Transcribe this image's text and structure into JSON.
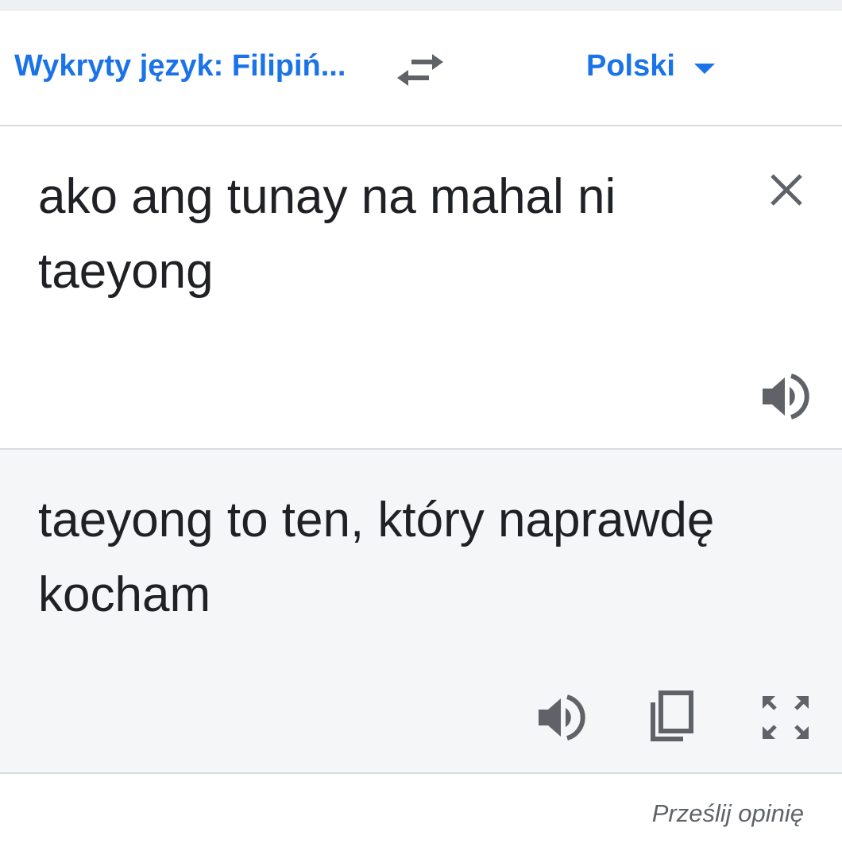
{
  "lang_bar": {
    "source_language": "Wykryty język: Filipiń...",
    "target_language": "Polski"
  },
  "source": {
    "text": "ako ang tunay na mahal ni taeyong"
  },
  "translation": {
    "text": "taeyong to ten, który naprawdę kocham"
  },
  "footer": {
    "feedback_label": "Prześlij opinię"
  },
  "icons": {
    "swap": "swap-arrows-icon",
    "dropdown": "caret-down-icon",
    "clear": "close-icon",
    "speaker": "speaker-icon",
    "copy": "copy-icon",
    "fullscreen": "fullscreen-icon"
  },
  "colors": {
    "accent": "#1a73e8",
    "icon": "#5f6368",
    "text": "#202124",
    "translation_bg": "#f5f6f8",
    "divider": "#dadce0"
  }
}
